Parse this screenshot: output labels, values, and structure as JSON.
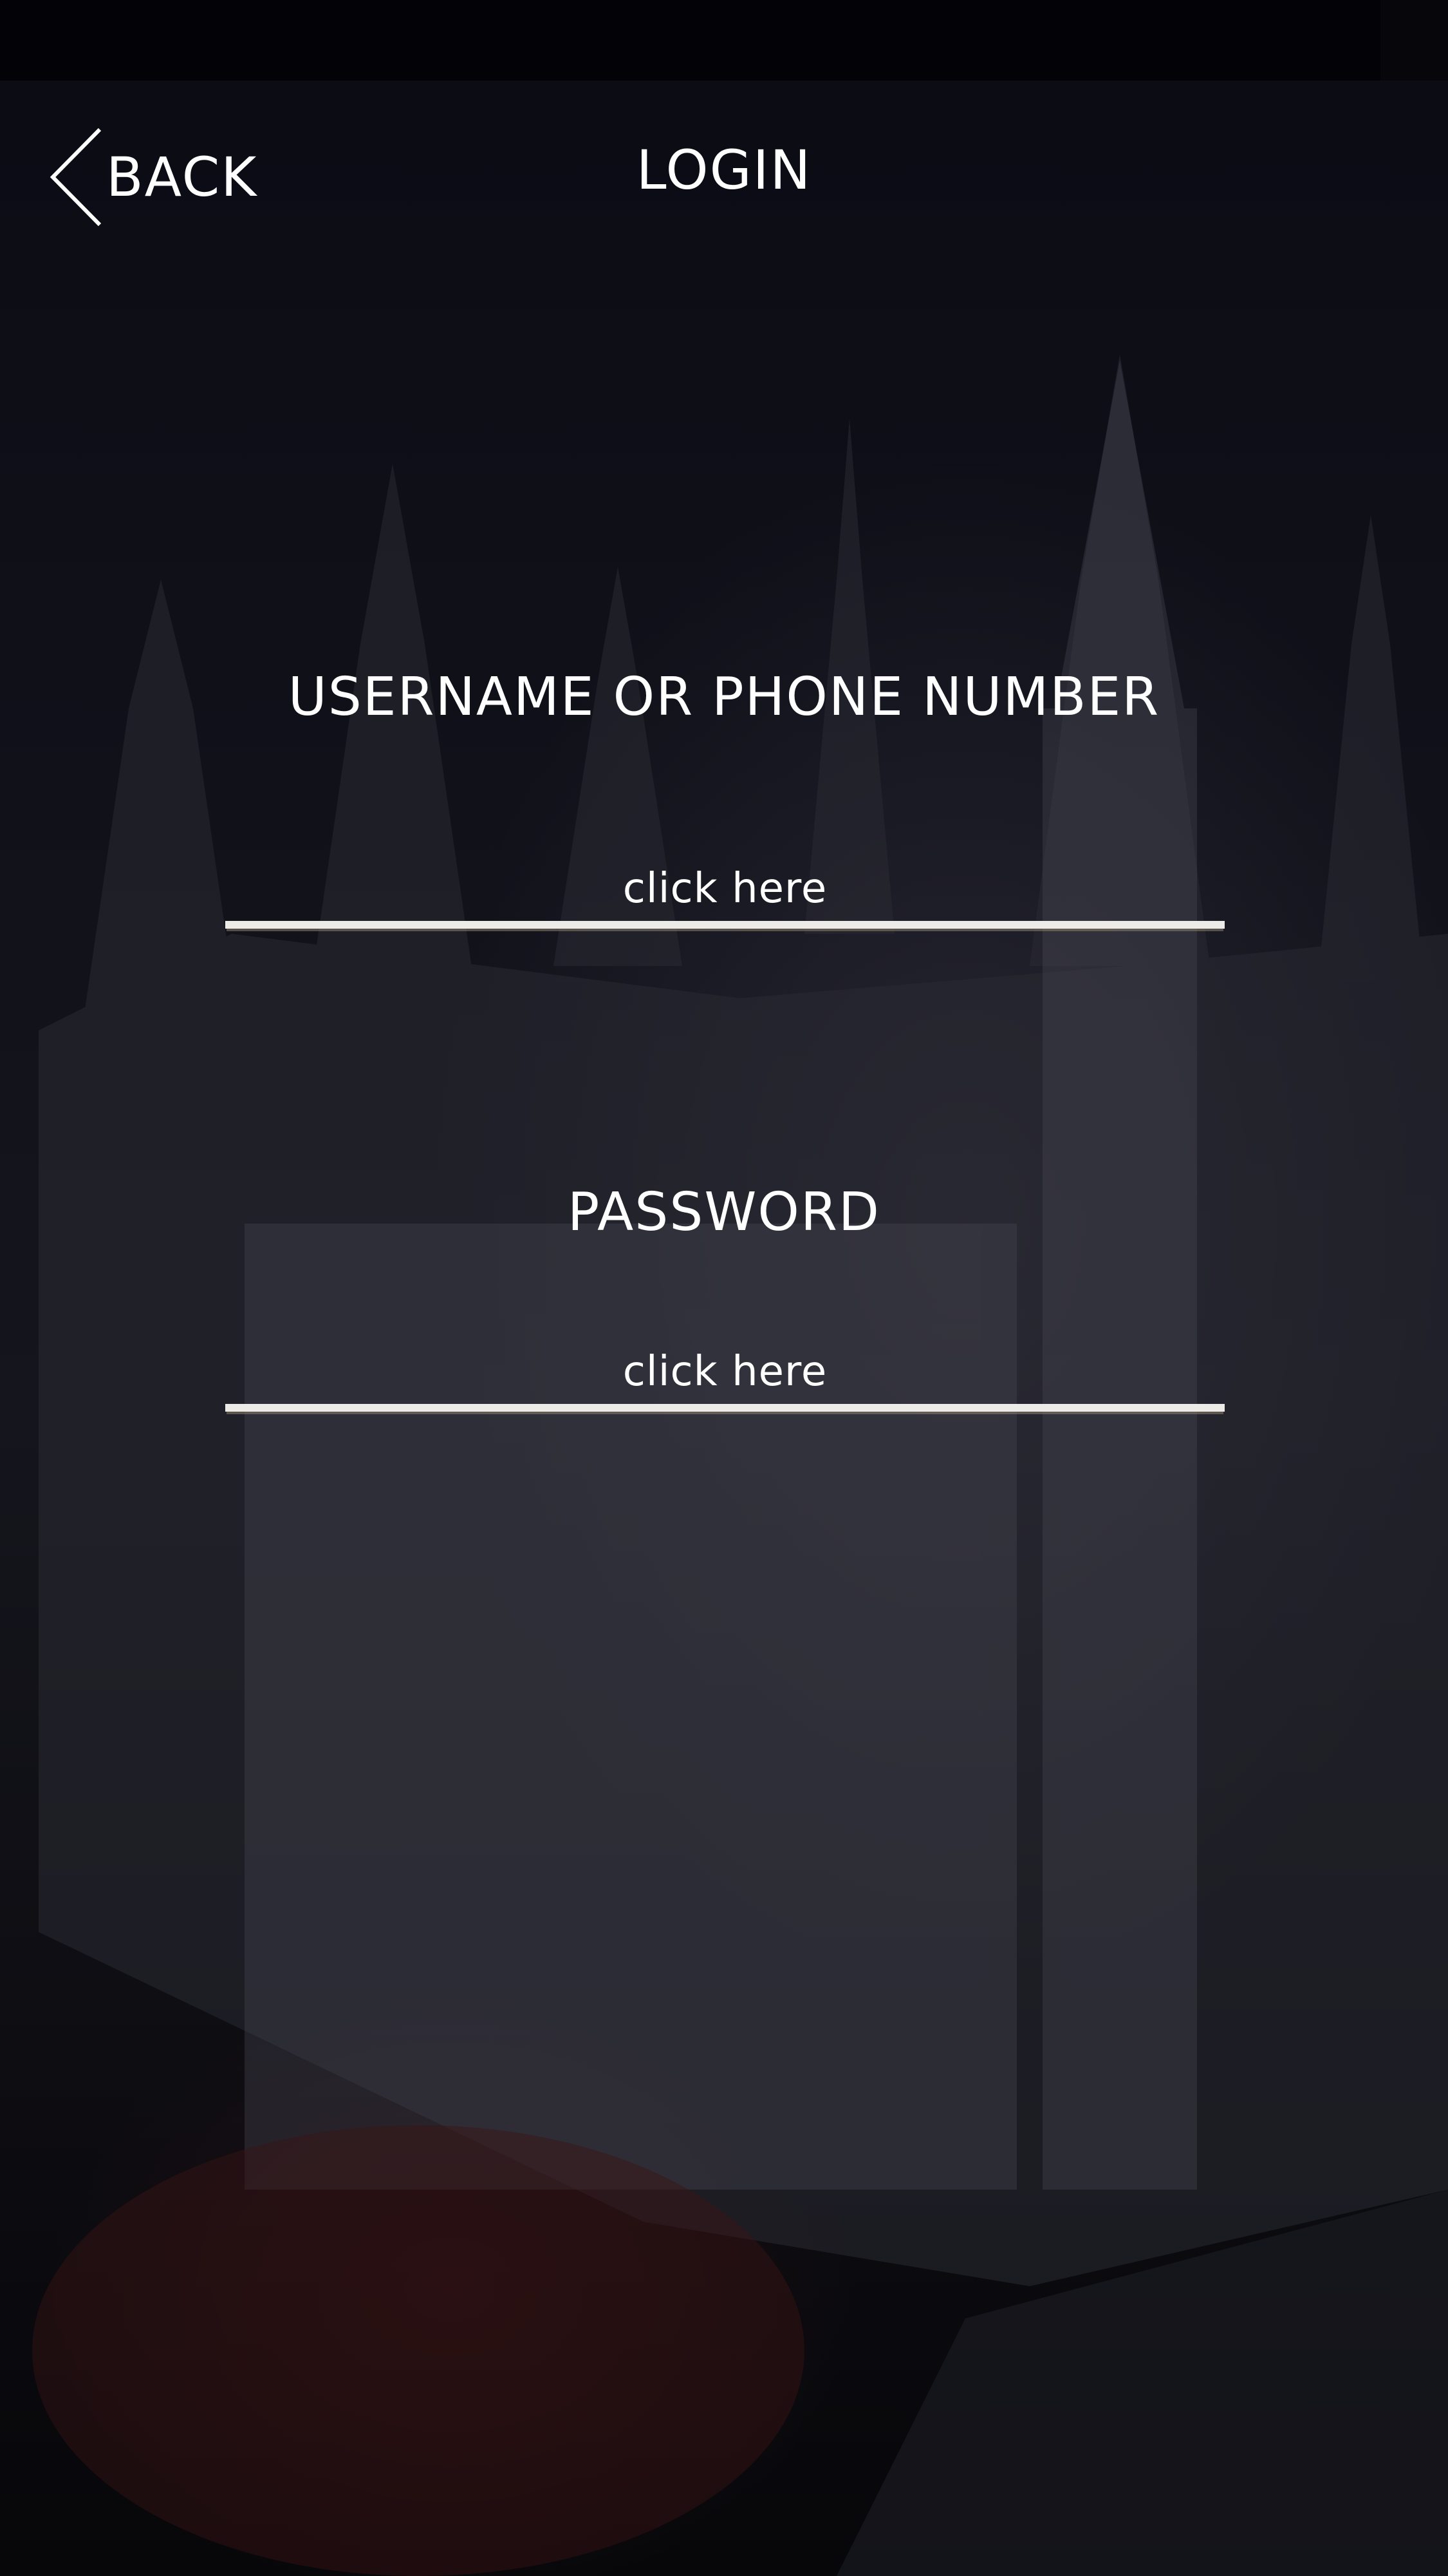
{
  "header": {
    "back_label": "BACK",
    "title": "LOGIN",
    "back_icon": "chevron-left-icon"
  },
  "form": {
    "username": {
      "label": "USERNAME OR PHONE NUMBER",
      "placeholder": "click here",
      "value": ""
    },
    "password": {
      "label": "PASSWORD",
      "placeholder": "click here",
      "value": ""
    }
  },
  "colors": {
    "text": "#ffffff",
    "underline": "#ecebe7",
    "background": "#0f0f17"
  }
}
